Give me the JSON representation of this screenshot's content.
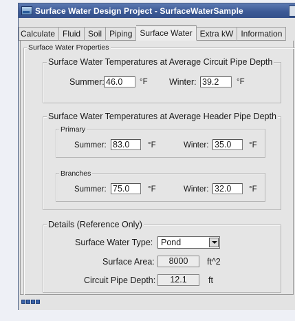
{
  "window": {
    "title": "Surface Water Design Project - SurfaceWaterSample"
  },
  "tabs": [
    "Calculate",
    "Fluid",
    "Soil",
    "Piping",
    "Surface Water",
    "Extra kW",
    "Information"
  ],
  "panel": {
    "title": "Surface Water Properties",
    "circuit": {
      "title": "Surface Water Temperatures at Average Circuit Pipe Depth",
      "summer_label": "Summer:",
      "summer_value": "46.0",
      "winter_label": "Winter:",
      "winter_value": "39.2",
      "unit": "°F"
    },
    "header": {
      "title": "Surface Water Temperatures at Average Header Pipe Depth",
      "primary": {
        "title": "Primary",
        "summer_label": "Summer:",
        "summer_value": "83.0",
        "winter_label": "Winter:",
        "winter_value": "35.0",
        "unit": "°F"
      },
      "branches": {
        "title": "Branches",
        "summer_label": "Summer:",
        "summer_value": "75.0",
        "winter_label": "Winter:",
        "winter_value": "32.0",
        "unit": "°F"
      }
    },
    "details": {
      "title": "Details (Reference Only)",
      "type_label": "Surface Water Type:",
      "type_value": "Pond",
      "area_label": "Surface Area:",
      "area_value": "8000",
      "area_unit": "ft^2",
      "depth_label": "Circuit Pipe Depth:",
      "depth_value": "12.1",
      "depth_unit": "ft"
    }
  }
}
